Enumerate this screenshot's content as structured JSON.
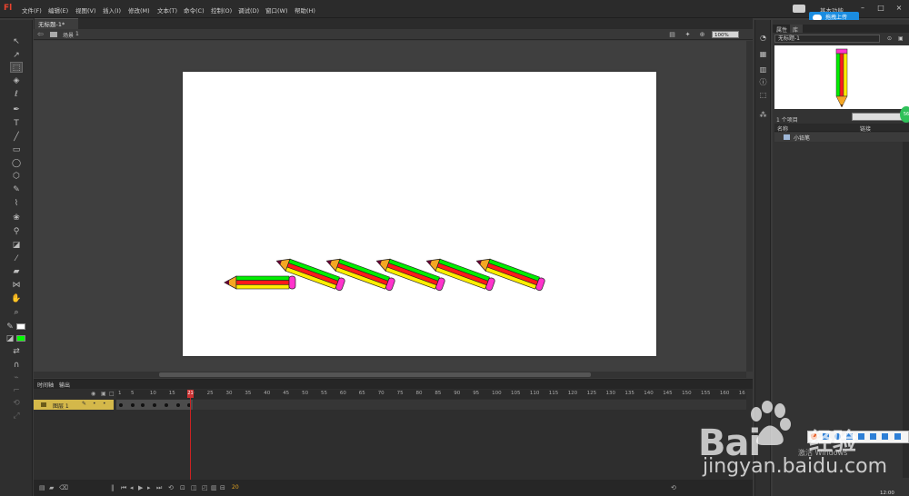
{
  "app": {
    "logo": "Fl",
    "workspace": "基本功能"
  },
  "menu": [
    "文件(F)",
    "编辑(E)",
    "视图(V)",
    "插入(I)",
    "修改(M)",
    "文本(T)",
    "命令(C)",
    "控制(O)",
    "调试(D)",
    "窗口(W)",
    "帮助(H)"
  ],
  "baidu_popup": "拖拽上传",
  "document": {
    "tab": "无标题-1*",
    "scene_label": "场景",
    "scene_number": "1",
    "zoom": "100%"
  },
  "colors": {
    "fill": "#00ff00",
    "stroke": "#ffffff",
    "stage": "#ffffff",
    "layer": "#d4b84a"
  },
  "timeline": {
    "tabs": [
      "时间轴",
      "输出"
    ],
    "ruler": [
      "1",
      "5",
      "10",
      "15",
      "20",
      "25",
      "30",
      "35",
      "40",
      "45",
      "50",
      "55",
      "60",
      "65",
      "70",
      "75",
      "80",
      "85",
      "90",
      "95",
      "100",
      "105",
      "110",
      "115",
      "120",
      "125",
      "130",
      "135",
      "140",
      "145",
      "150",
      "155",
      "160",
      "16"
    ],
    "playhead_frame": "21",
    "layer_name": "图层 1",
    "fps": "20"
  },
  "library": {
    "tabs": [
      "属性",
      "库"
    ],
    "doc": "无标题-1",
    "item_count": "1 个项目",
    "columns": {
      "name": "名称",
      "linkage": "链接"
    },
    "item": "小铅笔"
  },
  "icons": {
    "tools": [
      "selection-icon",
      "subselection-icon",
      "free-transform-icon",
      "3d-rotation-icon",
      "lasso-icon",
      "pen-icon",
      "text-icon",
      "line-icon",
      "rectangle-icon",
      "oval-icon",
      "polystar-icon",
      "pencil-icon",
      "brush-icon",
      "deco-icon",
      "bone-icon",
      "paint-bucket-icon",
      "eyedropper-icon",
      "eraser-icon",
      "width-icon",
      "hand-icon",
      "zoom-icon"
    ]
  },
  "watermark": {
    "brand": "Bai",
    "brand2": "经验",
    "site": "jingyan.baidu.com",
    "activate": "激活 Windows"
  },
  "clock": "12:00"
}
